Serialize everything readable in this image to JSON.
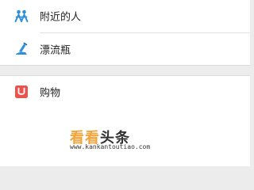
{
  "colors": {
    "nearby_icon": "#2e8fd8",
    "bottle_icon": "#2e8fd8",
    "shopping_icon": "#e9524d",
    "watermark_orange": "#f2a33a",
    "watermark_dark": "#333333"
  },
  "menu": {
    "nearby": {
      "label": "附近的人",
      "icon": "people-icon"
    },
    "drift_bottle": {
      "label": "漂流瓶",
      "icon": "drift-bottle-icon"
    },
    "shopping": {
      "label": "购物",
      "icon": "shopping-bag-icon"
    }
  },
  "watermark": {
    "brand_orange": "看看",
    "brand_dark": "头条",
    "url": "www.kankantoutiao.com"
  }
}
